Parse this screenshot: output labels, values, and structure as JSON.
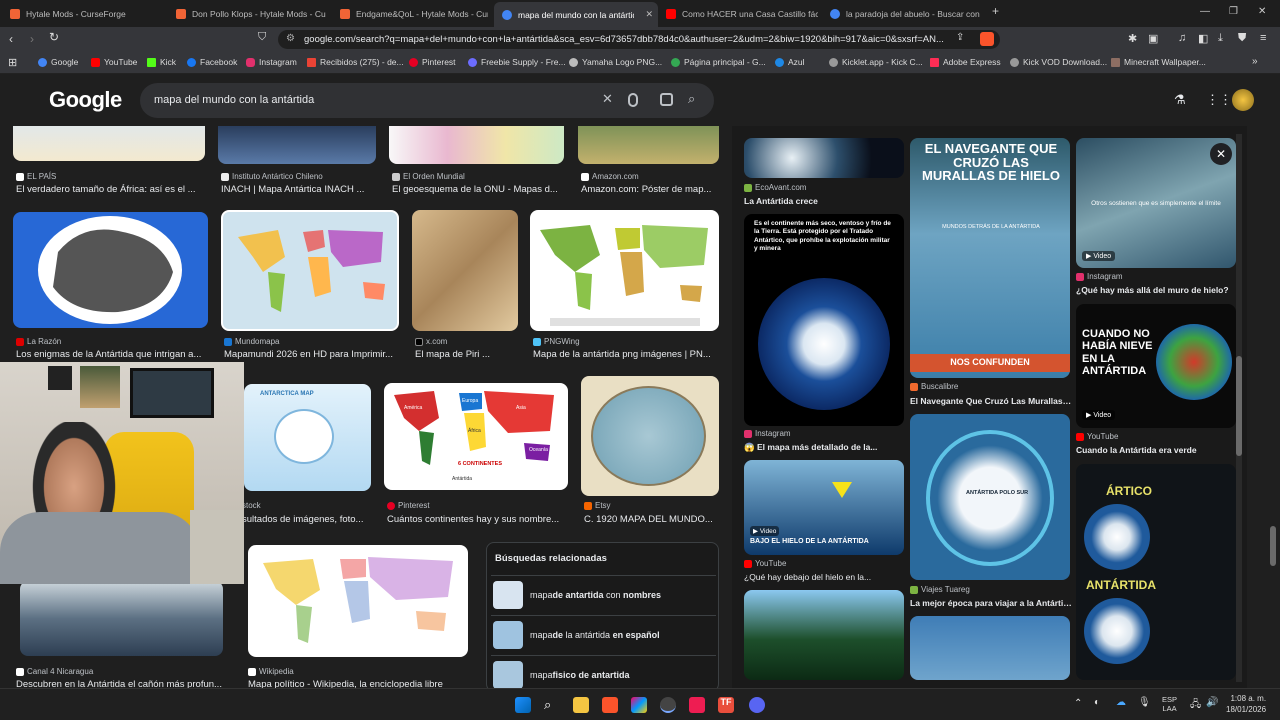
{
  "tabs": [
    {
      "title": "Hytale Mods - CurseForge",
      "color": "#f16436"
    },
    {
      "title": "Don Pollo Klops - Hytale Mods - Cur",
      "color": "#f16436"
    },
    {
      "title": "Endgame&QoL - Hytale Mods - Curs",
      "color": "#f16436"
    },
    {
      "title": "mapa del mundo con la antártida",
      "color": "#4285f4"
    },
    {
      "title": "Como HACER una Casa Castillo fácil",
      "color": "#ff0000"
    },
    {
      "title": "la paradoja del abuelo - Buscar con G",
      "color": "#4285f4"
    }
  ],
  "new_tab": "+",
  "address": "google.com/search?q=mapa+del+mundo+con+la+antártida&sca_esv=6d73657dbb78d4c0&authuser=2&udm=2&biw=1920&bih=917&aic=0&sxsrf=AN...",
  "bookmarks": [
    {
      "label": "Google",
      "color": "#4285f4"
    },
    {
      "label": "YouTube",
      "color": "#ff0000"
    },
    {
      "label": "Kick",
      "color": "#53fc18"
    },
    {
      "label": "Facebook",
      "color": "#1877f2"
    },
    {
      "label": "Instagram",
      "color": "#e1306c"
    },
    {
      "label": "Recibidos (275) - de...",
      "color": "#ea4335"
    },
    {
      "label": "Pinterest",
      "color": "#e60023"
    },
    {
      "label": "Freebie Supply - Fre...",
      "color": "#6c6cff"
    },
    {
      "label": "Yamaha Logo PNG...",
      "color": "#bbbbbb"
    },
    {
      "label": "Página principal - G...",
      "color": "#34a853"
    },
    {
      "label": "Azul",
      "color": "#1e88e5"
    },
    {
      "label": "Kicklet.app - Kick C...",
      "color": "#999999"
    },
    {
      "label": "Adobe Express",
      "color": "#ff2d55"
    },
    {
      "label": "Kick VOD Download...",
      "color": "#999999"
    },
    {
      "label": "Minecraft Wallpaper...",
      "color": "#8d6e63"
    }
  ],
  "google": {
    "logo": "Google",
    "query": "mapa del mundo con la antártida"
  },
  "results": {
    "row0": [
      {
        "source": "EL PAÍS",
        "title": "El verdadero tamaño de África: así es el ..."
      },
      {
        "source": "Instituto Antártico Chileno",
        "title": "INACH | Mapa Antártica INACH ..."
      },
      {
        "source": "El Orden Mundial",
        "title": "El geoesquema de la ONU - Mapas d..."
      },
      {
        "source": "Amazon.com",
        "title": "Amazon.com: Póster de map..."
      }
    ],
    "row1": [
      {
        "source": "La Razón",
        "title": "Los enigmas de la Antártida que intrigan a..."
      },
      {
        "source": "Mundomapa",
        "title": "Mapamundi 2026 en HD para Imprimir..."
      },
      {
        "source": "x.com",
        "title": "El mapa de Piri ..."
      },
      {
        "source": "PNGWing",
        "title": "Mapa de la antártida png imágenes | PN..."
      }
    ],
    "row2": [
      {
        "source": "stock",
        "title": "sultados de imágenes, foto..."
      },
      {
        "source": "Pinterest",
        "title": "Cuántos continentes hay y sus nombre..."
      },
      {
        "source": "Etsy",
        "title": "C. 1920 MAPA DEL MUNDO..."
      }
    ],
    "row3": [
      {
        "source": "Canal 4 Nicaragua",
        "title": "Descubren en la Antártida el cañón más profun..."
      },
      {
        "source": "Wikipedia",
        "title": "Mapa político - Wikipedia, la enciclopedia libre"
      }
    ],
    "img_texts": {
      "antarctica_map": "ANTARCTICA MAP",
      "six_continents": "6 CONTINENTES",
      "europa": "Europa",
      "asia": "Asia",
      "africa": "África",
      "america": "América",
      "oceania": "Oceanía",
      "antartida": "Antártida"
    }
  },
  "related": {
    "heading": "Búsquedas relacionadas",
    "items": [
      {
        "pre": "mapa ",
        "b1": "de antartida",
        "mid": " con ",
        "b2": "nombres"
      },
      {
        "pre": "mapa ",
        "b1": "de",
        "mid": " la antártida ",
        "b2": "en español"
      },
      {
        "pre": "mapa ",
        "b1": "fisico de antartida",
        "mid": "",
        "b2": ""
      }
    ]
  },
  "panel": {
    "close": "✕",
    "col1": [
      {
        "source": "EcoAvant.com",
        "title": "La Antártida crece"
      },
      {
        "source": "Instagram",
        "title": "😱 El mapa más detallado de la...",
        "img_text": "Es el continente más seco, ventoso y frío de la Tierra. Está protegido por el Tratado Antártico, que prohíbe la explotación militar y minera"
      },
      {
        "source": "YouTube",
        "title": "¿Qué hay debajo del hielo en la...",
        "badge": "Video",
        "img_text": "BAJO EL HIELO DE LA ANTÁRTIDA"
      }
    ],
    "col2": [
      {
        "source": "Buscalibre",
        "title": "El Navegante Que Cruzó Las Murallas de...",
        "img_text1": "EL NAVEGANTE QUE CRUZÓ LAS MURALLAS DE HIELO",
        "img_text2": "MUNDOS DETRÁS DE LA ANTÁRTIDA",
        "img_text3": "NOS CONFUNDEN"
      },
      {
        "source": "Viajes Tuareg",
        "title": "La mejor época para viajar a la Antártid...",
        "img_text": "ANTÁRTIDA POLO SUR"
      }
    ],
    "col3": [
      {
        "source": "Instagram",
        "title": "¿Qué hay más allá del muro de hielo?",
        "badge": "Video",
        "img_text": "Otros sostienen que es simplemente el límite"
      },
      {
        "source": "YouTube",
        "title": "Cuando la Antártida era verde",
        "badge": "Video",
        "img_text": "CUANDO NO HABÍA NIEVE EN LA ANTÁRTIDA"
      },
      {
        "source": "",
        "title": "",
        "img_text1": "ÁRTICO",
        "img_text2": "ANTÁRTIDA"
      }
    ]
  },
  "taskbar": {
    "lang1": "ESP",
    "lang2": "LAA",
    "time": "1:08 a. m.",
    "date": "18/01/2026"
  }
}
